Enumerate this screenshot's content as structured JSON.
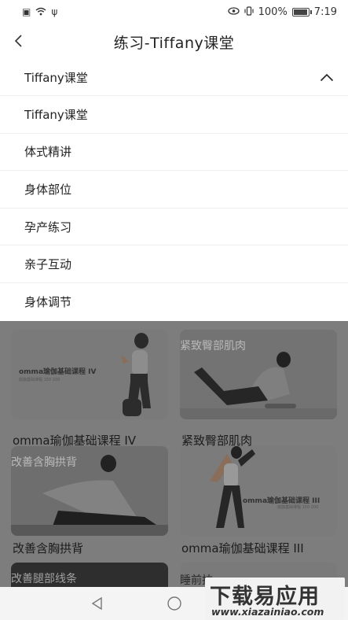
{
  "status_bar": {
    "battery_text": "100%",
    "time": "7:19"
  },
  "header": {
    "title": "练习-Tiffany课堂"
  },
  "dropdown": {
    "selected": "Tiffany课堂",
    "items": [
      "Tiffany课堂",
      "体式精讲",
      "身体部位",
      "孕产练习",
      "亲子互动",
      "身体调节"
    ]
  },
  "cards": [
    {
      "title": "omma瑜伽基础课程 IV",
      "thumb_caption": "omma瑜伽基础课程 IV",
      "thumb_sub": "瑜伽基础课程 150 200"
    },
    {
      "title": "紧致臀部肌肉",
      "overlay": "紧致臀部肌肉"
    },
    {
      "title": "改善含胸拱背",
      "overlay": "改善含胸拱背"
    },
    {
      "title": "omma瑜伽基础课程 III",
      "thumb_caption": "omma瑜伽基础课程 III",
      "thumb_sub": "瑜伽基础课程 150 200"
    },
    {
      "title": "",
      "overlay": "改善腿部线条"
    },
    {
      "title": "",
      "overlay": "睡前拉"
    }
  ],
  "watermark": {
    "main": "下载易应用",
    "url": "www.xiazainiao.com"
  },
  "colors": {
    "dim_overlay": "#7d7d7d",
    "divider": "#eeeeee"
  }
}
